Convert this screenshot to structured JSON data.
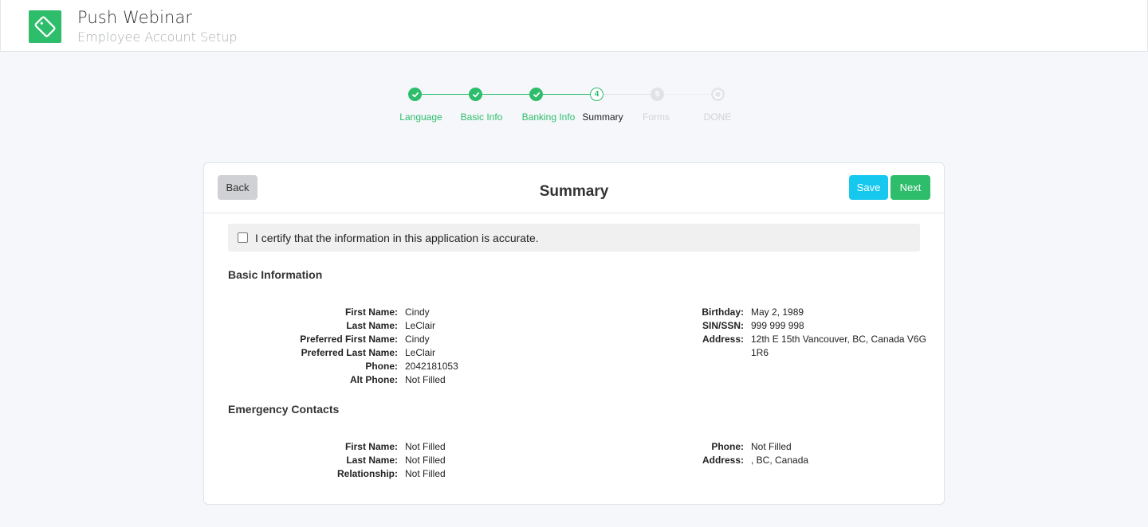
{
  "app": {
    "title": "Push Webinar",
    "subtitle": "Employee Account Setup",
    "logo_icon": "tag-icon",
    "brand_color": "#2ebd6b"
  },
  "stepper": {
    "steps": [
      {
        "label": "Language",
        "status": "done",
        "marker": "check"
      },
      {
        "label": "Basic Info",
        "status": "done",
        "marker": "check"
      },
      {
        "label": "Banking Info",
        "status": "done",
        "marker": "check"
      },
      {
        "label": "Summary",
        "status": "current",
        "marker": "4"
      },
      {
        "label": "Forms",
        "status": "future",
        "marker": "5"
      },
      {
        "label": "DONE",
        "status": "future",
        "marker": ""
      }
    ]
  },
  "card": {
    "title": "Summary",
    "back_label": "Back",
    "save_label": "Save",
    "next_label": "Next",
    "save_color": "#17c8ee",
    "next_color": "#2ebd6b",
    "certify_text": "I certify that the information in this application is accurate.",
    "certify_checked": false
  },
  "basic_info": {
    "title": "Basic Information",
    "left": [
      {
        "label": "First Name:",
        "value": "Cindy"
      },
      {
        "label": "Last Name:",
        "value": "LeClair"
      },
      {
        "label": "Preferred First Name:",
        "value": "Cindy"
      },
      {
        "label": "Preferred Last Name:",
        "value": "LeClair"
      },
      {
        "label": "Phone:",
        "value": "2042181053"
      },
      {
        "label": "Alt Phone:",
        "value": "Not Filled"
      }
    ],
    "right": [
      {
        "label": "Birthday:",
        "value": "May 2, 1989"
      },
      {
        "label": "SIN/SSN:",
        "value": "999 999 998"
      },
      {
        "label": "Address:",
        "value": "12th E 15th Vancouver, BC, Canada V6G",
        "value2": "1R6"
      }
    ]
  },
  "emergency": {
    "title": "Emergency Contacts",
    "left": [
      {
        "label": "First Name:",
        "value": "Not Filled"
      },
      {
        "label": "Last Name:",
        "value": "Not Filled"
      },
      {
        "label": "Relationship:",
        "value": "Not Filled"
      }
    ],
    "right": [
      {
        "label": "Phone:",
        "value": "Not Filled"
      },
      {
        "label": "Address:",
        "value": ", BC, Canada"
      }
    ]
  }
}
